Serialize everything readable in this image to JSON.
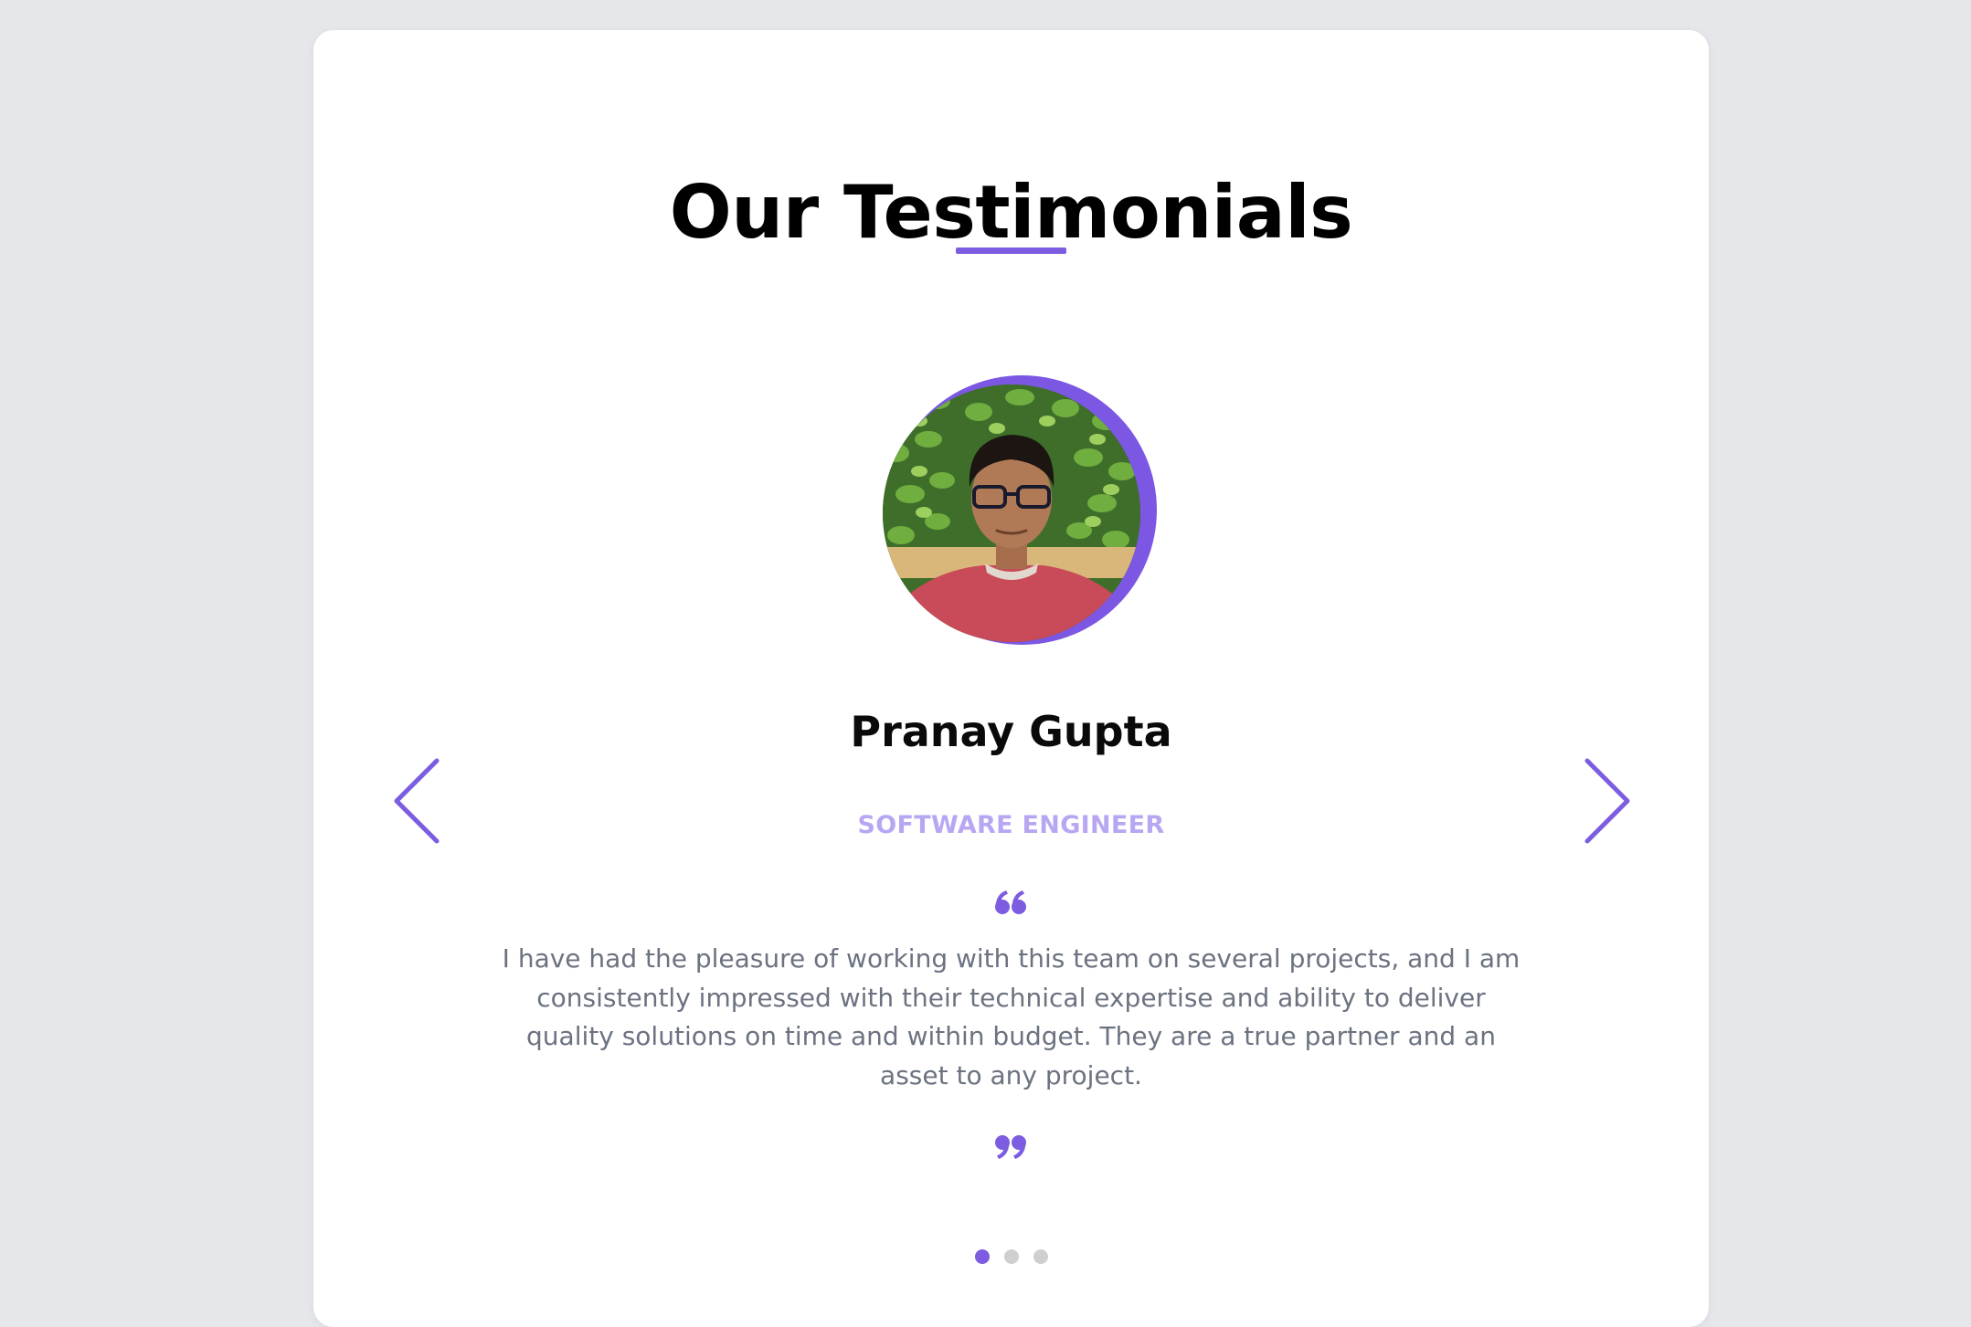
{
  "section": {
    "title": "Our Testimonials"
  },
  "testimonial": {
    "name": "Pranay Gupta",
    "role": "SOFTWARE ENGINEER",
    "quote": "I have had the pleasure of working with this team on several projects, and I am consistently impressed with their technical expertise and ability to deliver quality solutions on time and within budget. They are a true partner and an asset to any project."
  },
  "carousel": {
    "active_index": 0,
    "total": 3
  },
  "icons": {
    "prev": "chevron-left-icon",
    "next": "chevron-right-icon",
    "quote_open": "quote-open-icon",
    "quote_close": "quote-close-icon"
  },
  "colors": {
    "accent": "#7c5ce0",
    "role_text": "#b9a6f3",
    "body_text": "#6b7280",
    "page_background": "#e5e7eb",
    "card_background": "#ffffff",
    "dot_inactive": "#cfcfcf"
  }
}
